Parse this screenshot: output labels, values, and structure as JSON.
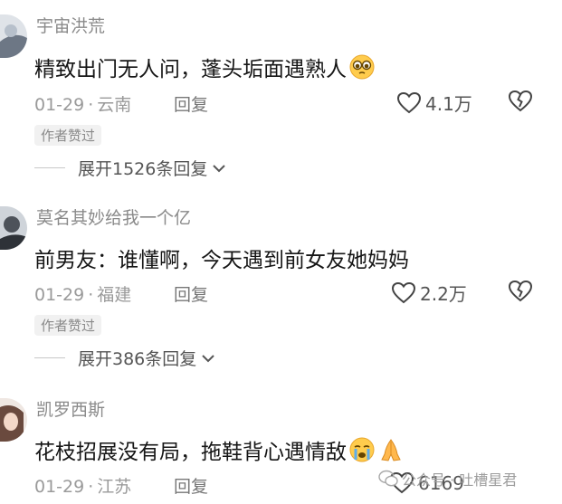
{
  "comments": [
    {
      "username": "宇宙洪荒",
      "content": "精致出门无人问，蓬头垢面遇熟人",
      "emoji": "pleading-face",
      "date": "01-29",
      "location": "云南",
      "reply_label": "回复",
      "likes": "4.1万",
      "badge": "作者赞过",
      "expand_label": "展开1526条回复"
    },
    {
      "username": "莫名其妙给我一个亿",
      "content": "前男友：谁懂啊，今天遇到前女友她妈妈",
      "date": "01-29",
      "location": "福建",
      "reply_label": "回复",
      "likes": "2.2万",
      "badge": "作者赞过",
      "expand_label": "展开386条回复"
    },
    {
      "username": "凯罗西斯",
      "content": "花枝招展没有局，拖鞋背心遇情敌",
      "emoji": "crying-face, folded-hands",
      "date": "01-29",
      "location": "江苏",
      "reply_label": "回复",
      "likes": "6169"
    }
  ],
  "separator": "·",
  "watermark": {
    "text": "公众号 · 吐槽星君"
  }
}
